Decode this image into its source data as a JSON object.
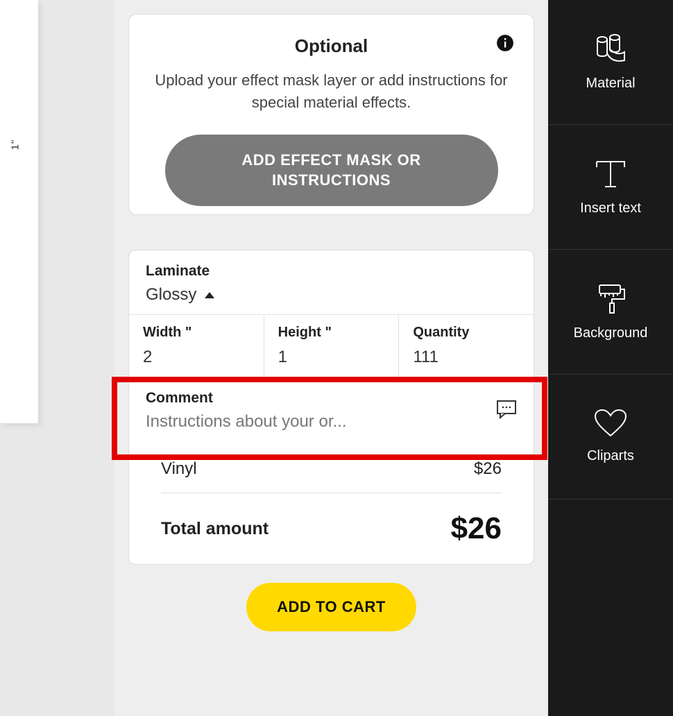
{
  "ruler": {
    "mark": "1\""
  },
  "optional": {
    "title": "Optional",
    "description": "Upload your effect mask layer or add instructions for special material effects.",
    "button": "ADD EFFECT MASK OR INSTRUCTIONS"
  },
  "config": {
    "laminate": {
      "label": "Laminate",
      "value": "Glossy"
    },
    "width": {
      "label": "Width \"",
      "value": "2"
    },
    "height": {
      "label": "Height \"",
      "value": "1"
    },
    "quantity": {
      "label": "Quantity",
      "value": "111"
    },
    "comment": {
      "label": "Comment",
      "placeholder": "Instructions about your or..."
    }
  },
  "summary": {
    "item_name": "Vinyl",
    "item_price": "$26",
    "total_label": "Total amount",
    "total_value": "$26"
  },
  "cart_button": "ADD TO CART",
  "sidebar": {
    "items": [
      {
        "label": "Material"
      },
      {
        "label": "Insert text"
      },
      {
        "label": "Background"
      },
      {
        "label": "Cliparts"
      }
    ]
  }
}
